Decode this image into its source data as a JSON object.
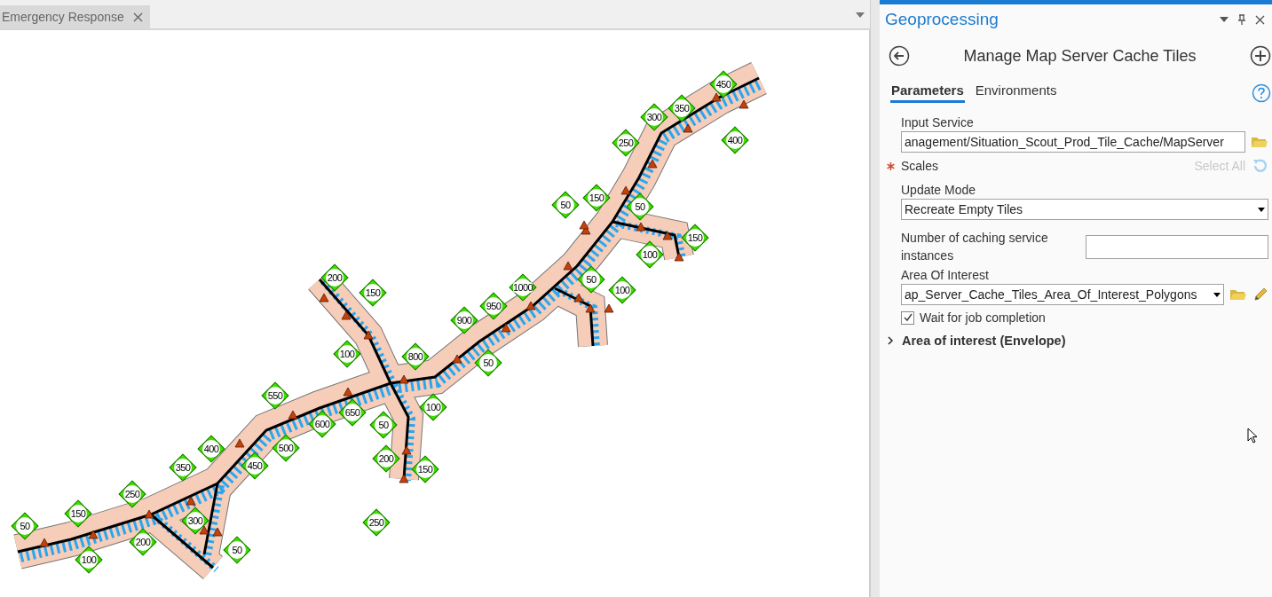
{
  "document_tab": {
    "label": "Emergency Response",
    "selected": true
  },
  "map": {
    "labels": [
      {
        "text": "50"
      },
      {
        "text": "150"
      },
      {
        "text": "100"
      },
      {
        "text": "250"
      },
      {
        "text": "200"
      },
      {
        "text": "350"
      },
      {
        "text": "300"
      },
      {
        "text": "400"
      },
      {
        "text": "450"
      },
      {
        "text": "50"
      },
      {
        "text": "500"
      },
      {
        "text": "550"
      },
      {
        "text": "600"
      },
      {
        "text": "650"
      },
      {
        "text": "50"
      },
      {
        "text": "100"
      },
      {
        "text": "200"
      },
      {
        "text": "150"
      },
      {
        "text": "250"
      },
      {
        "text": "100"
      },
      {
        "text": "800"
      },
      {
        "text": "200"
      },
      {
        "text": "150"
      },
      {
        "text": "900"
      },
      {
        "text": "950"
      },
      {
        "text": "1000"
      },
      {
        "text": "50"
      },
      {
        "text": "50"
      },
      {
        "text": "100"
      },
      {
        "text": "50"
      },
      {
        "text": "150"
      },
      {
        "text": "50"
      },
      {
        "text": "100"
      },
      {
        "text": "150"
      },
      {
        "text": "250"
      },
      {
        "text": "300"
      },
      {
        "text": "350"
      },
      {
        "text": "450"
      },
      {
        "text": "400"
      }
    ]
  },
  "pane": {
    "title": "Geoprocessing",
    "tool_title": "Manage Map Server Cache Tiles",
    "tabs": [
      {
        "label": "Parameters",
        "selected": true
      },
      {
        "label": "Environments",
        "selected": false
      }
    ],
    "parameters": [
      {
        "kind": "text",
        "label": "Input Service",
        "value": "anagement/Situation_Scout_Prod_Tile_Cache/MapServer"
      },
      {
        "kind": "scales",
        "label": "Scales",
        "required": true,
        "action": "Select All",
        "action_disabled": true
      },
      {
        "kind": "dropdown",
        "label": "Update Mode",
        "value": "Recreate Empty Tiles"
      },
      {
        "kind": "number",
        "label": "Number of caching service instances"
      },
      {
        "kind": "layer",
        "label": "Area Of Interest",
        "value": "ap_Server_Cache_Tiles_Area_Of_Interest_Polygons"
      },
      {
        "kind": "checkbox",
        "label": "Wait for job completion",
        "checked": true
      },
      {
        "kind": "group",
        "label": "Area of interest (Envelope)",
        "expanded": false
      }
    ]
  }
}
